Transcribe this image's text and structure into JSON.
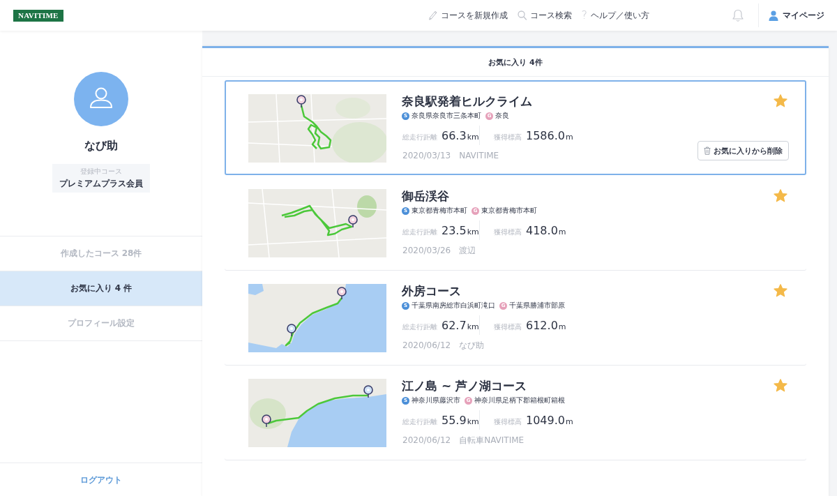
{
  "header": {
    "logo": "NAVITIME",
    "nav": [
      {
        "kind": "create",
        "label": "コースを新規作成"
      },
      {
        "kind": "search",
        "label": "コース検索"
      },
      {
        "kind": "help",
        "glyph": "?",
        "label": "ヘルプ／使い方"
      }
    ],
    "account": "マイページ"
  },
  "sidebar": {
    "user_name": "なび助",
    "membership": {
      "label": "登録中コース",
      "plan": "プレミアムプラス会員"
    },
    "items": [
      {
        "label": "作成したコース 28件",
        "selected": false
      },
      {
        "label": "お気に入り 4 件",
        "selected": true
      },
      {
        "label": "プロフィール設定",
        "selected": false
      }
    ],
    "logout": "ログアウト"
  },
  "panel": {
    "title": "お気に入り 4件",
    "cards": [
      {
        "title": "奈良駅発着ヒルクライム",
        "selected": true,
        "favorite": true,
        "start": {
          "marker": "S",
          "place": "奈良県奈良市三条本町"
        },
        "goal": {
          "marker": "G",
          "place": "奈良"
        },
        "distance": {
          "label": "総走行距離",
          "value": "66.3",
          "unit": "km"
        },
        "elevation": {
          "label": "獲得標高",
          "value": "1586.0",
          "unit": "m"
        },
        "date": "2020/03/13",
        "author": "NAVITIME",
        "delete_button": "お気に入りから削除"
      },
      {
        "title": "御岳渓谷",
        "selected": false,
        "favorite": true,
        "start": {
          "marker": "S",
          "place": "東京都青梅市本町"
        },
        "goal": {
          "marker": "G",
          "place": "東京都青梅市本町"
        },
        "distance": {
          "label": "総走行距離",
          "value": "23.5",
          "unit": "km"
        },
        "elevation": {
          "label": "獲得標高",
          "value": "418.0",
          "unit": "m"
        },
        "date": "2020/03/26",
        "author": "渡辺"
      },
      {
        "title": "外房コース",
        "selected": false,
        "favorite": true,
        "start": {
          "marker": "S",
          "place": "千葉県南房総市白浜町滝口"
        },
        "goal": {
          "marker": "G",
          "place": "千葉県勝浦市部原"
        },
        "distance": {
          "label": "総走行距離",
          "value": "62.7",
          "unit": "km"
        },
        "elevation": {
          "label": "獲得標高",
          "value": "612.0",
          "unit": "m"
        },
        "date": "2020/06/12",
        "author": "なび助"
      },
      {
        "title": "江ノ島 ~ 芦ノ湖コース",
        "selected": false,
        "favorite": true,
        "start": {
          "marker": "S",
          "place": "神奈川県藤沢市"
        },
        "goal": {
          "marker": "G",
          "place": "神奈川県足柄下郡箱根町箱根"
        },
        "distance": {
          "label": "総走行距離",
          "value": "55.9",
          "unit": "km"
        },
        "elevation": {
          "label": "獲得標高",
          "value": "1049.0",
          "unit": "m"
        },
        "date": "2020/06/12",
        "author": "自転車NAVITIME"
      }
    ]
  }
}
